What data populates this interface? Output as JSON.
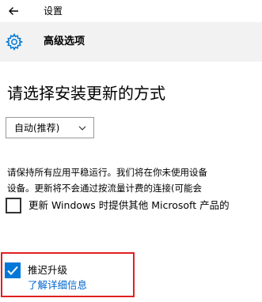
{
  "titlebar": {
    "back_icon": "back-arrow-icon",
    "title": "设置"
  },
  "header": {
    "icon": "gear-icon",
    "title": "高级选项"
  },
  "main": {
    "heading": "请选择安装更新的方式",
    "install_mode": {
      "selected": "自动(推荐)",
      "icon": "chevron-down-icon"
    },
    "description_line1": "请保持所有应用平稳运行。我们将在你未使用设备",
    "description_line2": "设备。更新将不会通过按流量计费的连接(可能会",
    "other_products": {
      "label": "更新 Windows 时提供其他 Microsoft 产品的",
      "checked": false
    },
    "defer_upgrades": {
      "label": "推迟升级",
      "checked": true,
      "link": "了解详细信息"
    }
  },
  "colors": {
    "accent": "#0078d7",
    "link": "#0066cc",
    "highlight_border": "#e02020",
    "header_bg": "#f2f2f2"
  }
}
